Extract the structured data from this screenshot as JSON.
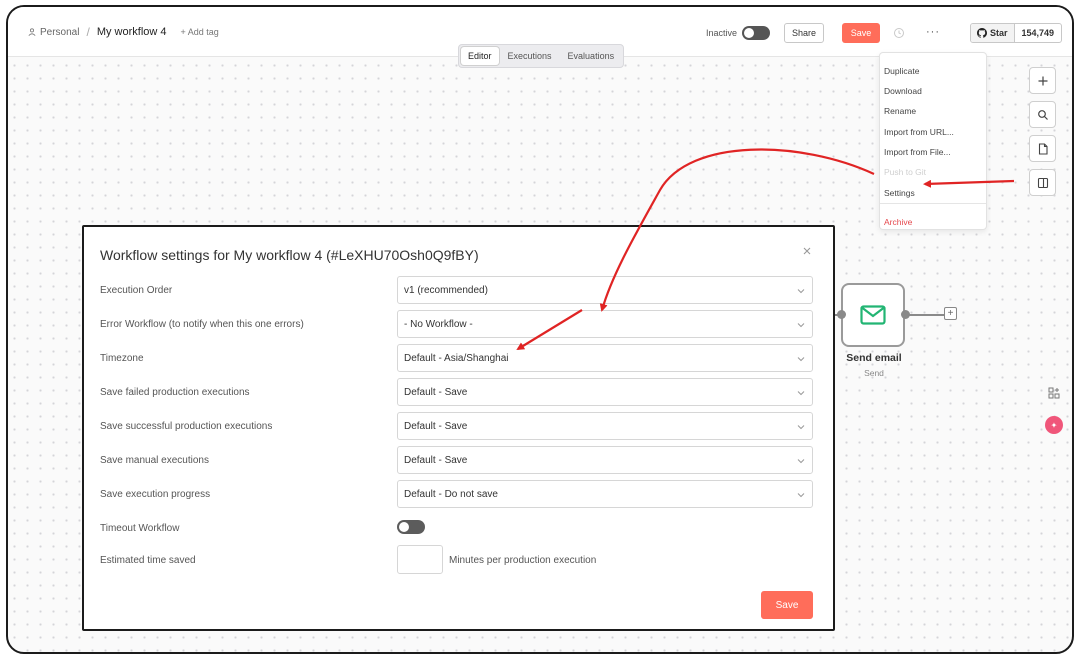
{
  "header": {
    "breadcrumb_owner": "Personal",
    "workflow_name": "My workflow 4",
    "add_tag": "+ Add tag",
    "status": "Inactive",
    "share": "Share",
    "save": "Save",
    "more": "···",
    "github_star": "Star",
    "github_count": "154,749"
  },
  "tabs": [
    "Editor",
    "Executions",
    "Evaluations"
  ],
  "menu": {
    "items": [
      "Duplicate",
      "Download",
      "Rename",
      "Import from URL...",
      "Import from File...",
      "Push to Git",
      "Settings",
      "Archive"
    ]
  },
  "node": {
    "title": "Send email",
    "subtitle": "Send"
  },
  "modal": {
    "title": "Workflow settings for My workflow 4 (#LeXHU70Osh0Q9fBY)",
    "rows": [
      {
        "label": "Execution Order",
        "value": "v1 (recommended)"
      },
      {
        "label": "Error Workflow (to notify when this one errors)",
        "value": "- No Workflow -"
      },
      {
        "label": "Timezone",
        "value": "Default - Asia/Shanghai"
      },
      {
        "label": "Save failed production executions",
        "value": "Default - Save"
      },
      {
        "label": "Save successful production executions",
        "value": "Default - Save"
      },
      {
        "label": "Save manual executions",
        "value": "Default - Save"
      },
      {
        "label": "Save execution progress",
        "value": "Default - Do not save"
      }
    ],
    "timeout_label": "Timeout Workflow",
    "time_saved_label": "Estimated time saved",
    "time_saved_caption": "Minutes per production execution",
    "save": "Save"
  },
  "colors": {
    "accent": "#ff6d5a",
    "annotation": "#e02424",
    "danger": "#e5484d",
    "node_icon": "#22b573"
  }
}
